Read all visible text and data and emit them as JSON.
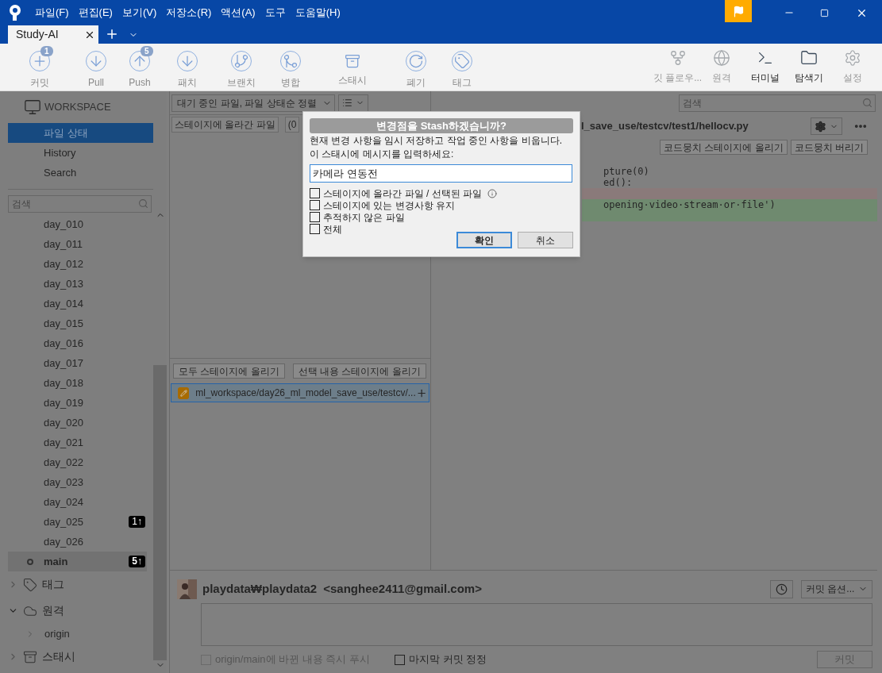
{
  "menu": [
    "파일(F)",
    "편집(E)",
    "보기(V)",
    "저장소(R)",
    "액션(A)",
    "도구",
    "도움말(H)"
  ],
  "tabs": [
    {
      "label": "Study-AI",
      "selected": true
    }
  ],
  "toolbar_left": [
    {
      "label": "커밋",
      "badge": "1"
    },
    {
      "label": "Pull"
    },
    {
      "label": "Push",
      "badge": "5"
    },
    {
      "label": "패치"
    },
    {
      "label": "브랜치"
    },
    {
      "label": "병합"
    },
    {
      "label": "스태시"
    },
    {
      "label": "폐기"
    },
    {
      "label": "태그"
    }
  ],
  "toolbar_right": [
    {
      "label": "깃 플로우...",
      "enabled": false
    },
    {
      "label": "원격",
      "enabled": false
    },
    {
      "label": "터미널",
      "enabled": true
    },
    {
      "label": "탐색기",
      "enabled": true
    },
    {
      "label": "설정",
      "enabled": false
    }
  ],
  "sidebar": {
    "workspace": "WORKSPACE",
    "items": [
      {
        "label": "파일 상태",
        "selected": true
      },
      {
        "label": "History",
        "selected": false
      },
      {
        "label": "Search",
        "selected": false
      }
    ],
    "search_placeholder": "검색",
    "branches": [
      {
        "name": "day_010",
        "current": false
      },
      {
        "name": "day_011",
        "current": false
      },
      {
        "name": "day_012",
        "current": false
      },
      {
        "name": "day_013",
        "current": false
      },
      {
        "name": "day_014",
        "current": false
      },
      {
        "name": "day_015",
        "current": false
      },
      {
        "name": "day_016",
        "current": false
      },
      {
        "name": "day_017",
        "current": false
      },
      {
        "name": "day_018",
        "current": false
      },
      {
        "name": "day_019",
        "current": false
      },
      {
        "name": "day_020",
        "current": false
      },
      {
        "name": "day_021",
        "current": false
      },
      {
        "name": "day_022",
        "current": false
      },
      {
        "name": "day_023",
        "current": false
      },
      {
        "name": "day_024",
        "current": false
      },
      {
        "name": "day_025",
        "current": false,
        "badge": "1↑"
      },
      {
        "name": "day_026",
        "current": false
      },
      {
        "name": "main",
        "current": true,
        "badge": "5↑"
      }
    ],
    "sections": [
      {
        "label": "태그",
        "expanded": false
      },
      {
        "label": "원격",
        "expanded": true,
        "children": [
          {
            "label": "origin",
            "expanded": false
          }
        ]
      },
      {
        "label": "스태시",
        "expanded": false
      }
    ]
  },
  "files_pane": {
    "sort": "대기 중인 파일, 파일 상태순 정렬",
    "staged_label": "스테이지에 올라간 파일",
    "staged_count": "(0",
    "buttons": [
      "모두 스테이지에 올리기",
      "선택 내용 스테이지에 올리기"
    ],
    "files": [
      {
        "path": "ml_workspace/day26_ml_model_save_use/testcv/...",
        "selected": true
      }
    ]
  },
  "search_placeholder": "검색",
  "diff": {
    "path": "l_save_use/testcv/test1/hellocv.py",
    "hunk_buttons": [
      "코드뭉치 스테이지에 올리기",
      "코드뭉치 버리기"
    ],
    "lines": [
      {
        "kind": "context",
        "text": "pture(0)"
      },
      {
        "kind": "context",
        "text": "ed():"
      },
      {
        "kind": "removed"
      },
      {
        "kind": "added",
        "text": "opening·video·stream·or·file')"
      },
      {
        "kind": "added"
      }
    ]
  },
  "commit": {
    "author": "playdata₩playdata2",
    "email": "<sanghee2411@gmail.com>",
    "options": "커밋 옵션...",
    "push": {
      "label": "origin/main에 바뀐 내용 즉시 푸시",
      "checked": false,
      "disabled": true
    },
    "amend": {
      "label": "마지막 커밋 정정",
      "checked": false
    },
    "button": "커밋"
  },
  "dialog": {
    "title": "변경점을 Stash하겠습니까?",
    "message": [
      "현재 변경 사항을 임시 저장하고 작업 중인 사항을 비웁니다.",
      "이 스태시에 메시지를 입력하세요:"
    ],
    "value": "카메라 연동전",
    "options": [
      {
        "label": "스테이지에 올라간 파일 / 선택된 파일",
        "checked": false,
        "info": true
      },
      {
        "label": "스테이지에 있는 변경사항 유지",
        "checked": false,
        "info": false
      },
      {
        "label": "추적하지 않은 파일",
        "checked": false,
        "info": false
      },
      {
        "label": "전체",
        "checked": false,
        "info": false
      }
    ],
    "buttons": [
      {
        "label": "확인",
        "default": true
      },
      {
        "label": "취소",
        "default": false
      }
    ]
  }
}
